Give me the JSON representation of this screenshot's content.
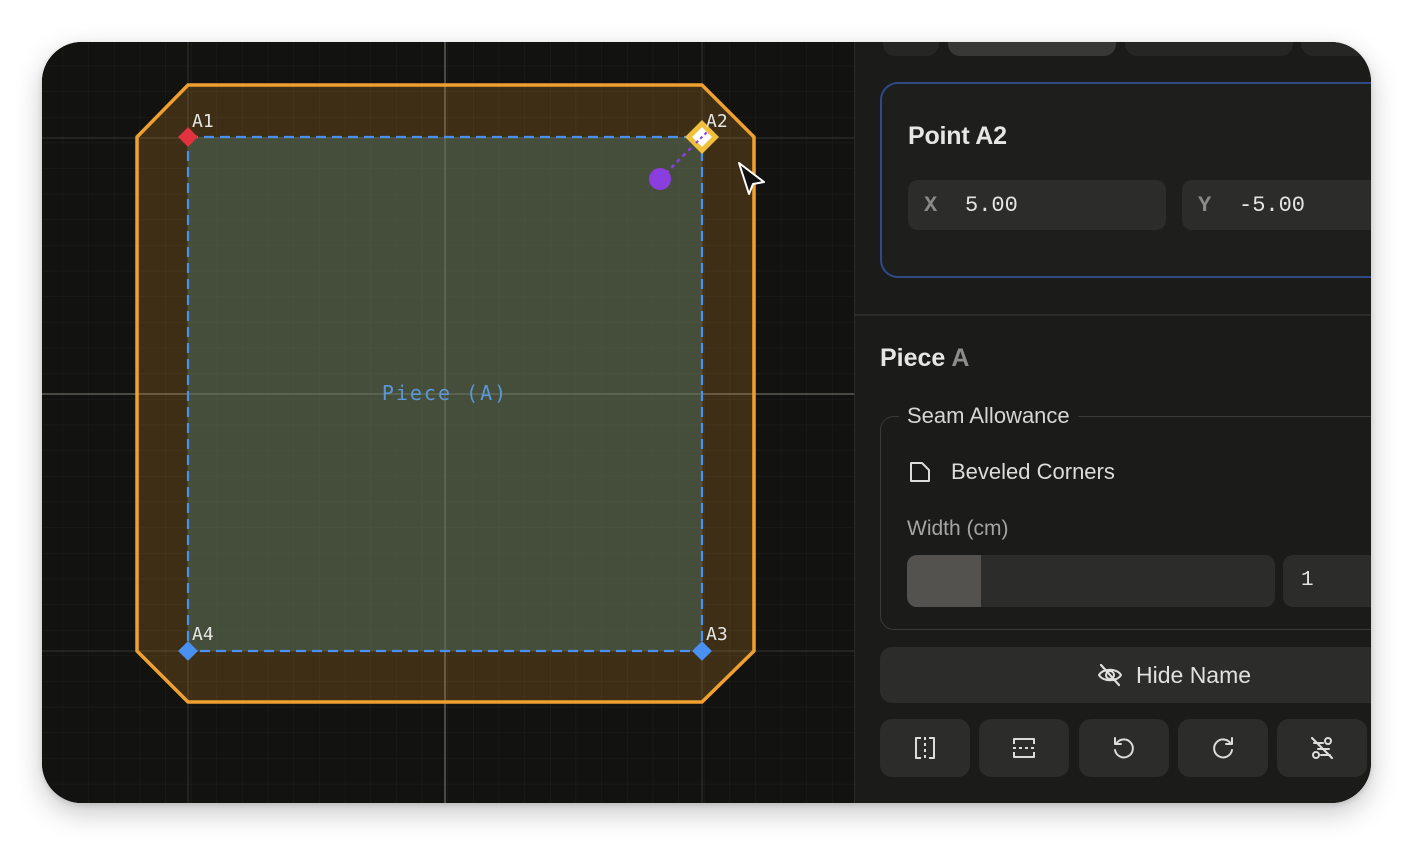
{
  "canvas": {
    "piece_label": "Piece (A)",
    "points": [
      {
        "name": "A1",
        "status": "start",
        "color": "#e0323f"
      },
      {
        "name": "A2",
        "status": "selected",
        "color": "#f0c03c"
      },
      {
        "name": "A3",
        "status": "normal",
        "color": "#4a90f0"
      },
      {
        "name": "A4",
        "status": "normal",
        "color": "#4a90f0"
      }
    ],
    "colors": {
      "background": "#121210",
      "seam_outline": "#f0a030",
      "seam_fill": "#3a2c18",
      "piece_outline": "#4a90f0",
      "piece_fill": "#3a4840",
      "control_handle": "#8a3ee0"
    }
  },
  "panel": {
    "point": {
      "title": "Point A2",
      "x_axis_label": "X",
      "x_value": "5.00",
      "y_axis_label": "Y",
      "y_value": "-5.00"
    },
    "piece": {
      "title_prefix": "Piece",
      "title_letter": "A",
      "seam_allowance": {
        "legend": "Seam Allowance",
        "corner_style": "Beveled Corners",
        "width_label": "Width (cm)",
        "width_value": "1",
        "slider_fraction": 0.2
      },
      "hide_name_label": "Hide Name",
      "tools": [
        {
          "icon": "flip-horizontal-icon"
        },
        {
          "icon": "flip-vertical-icon"
        },
        {
          "icon": "rotate-ccw-icon"
        },
        {
          "icon": "rotate-cw-icon"
        },
        {
          "icon": "unlink-points-icon"
        }
      ]
    },
    "accent_color": "#2f4a86"
  }
}
